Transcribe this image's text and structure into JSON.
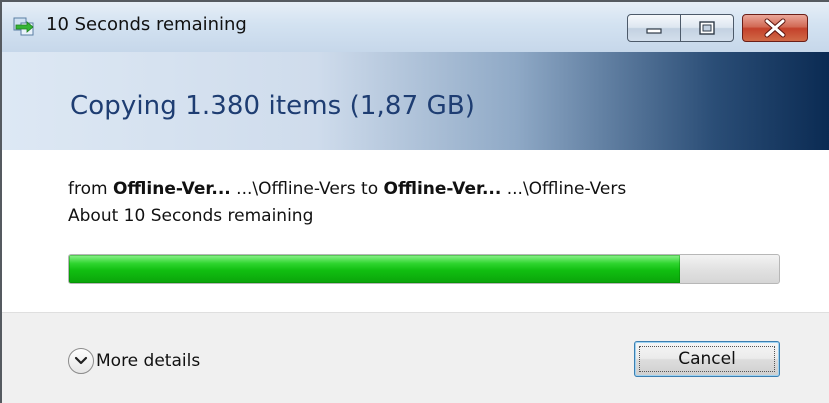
{
  "window": {
    "title": "10 Seconds remaining",
    "controls": {
      "minimize_icon": "minimize-icon",
      "maximize_icon": "maximize-icon",
      "close_icon": "close-icon"
    }
  },
  "header": {
    "title": "Copying 1.380 items (1,87 GB)"
  },
  "details": {
    "from_prefix": "from",
    "from_name": "Offline-Ver...",
    "from_path": "...\\Offline-Vers",
    "to_prefix": "to",
    "to_name": "Offline-Ver...",
    "to_path": "...\\Offline-Vers",
    "time_remaining": "About 10 Seconds remaining"
  },
  "progress": {
    "fraction": 0.86,
    "color": "#19c219"
  },
  "footer": {
    "more_details_label": "More details",
    "cancel_label": "Cancel"
  }
}
